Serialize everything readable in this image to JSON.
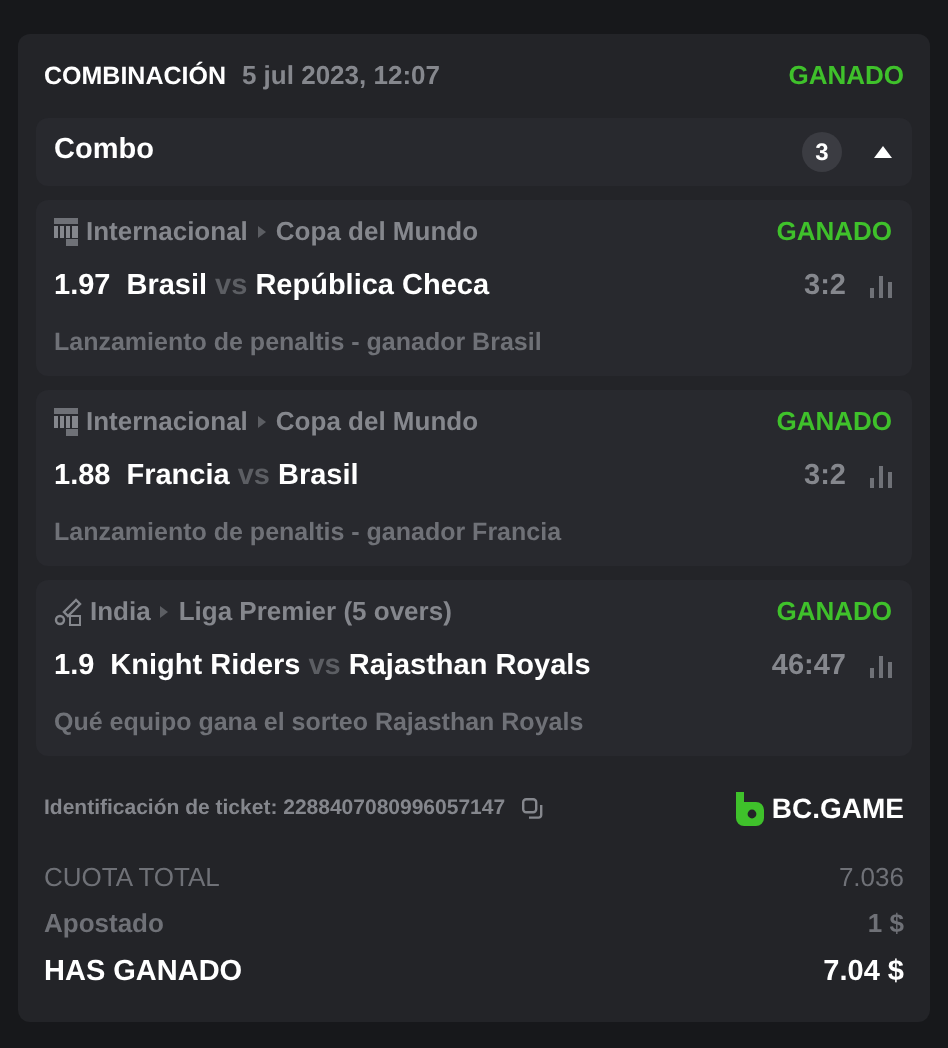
{
  "header": {
    "type": "COMBINACIÓN",
    "date": "5 jul 2023, 12:07",
    "status": "GANADO"
  },
  "combo": {
    "label": "Combo",
    "count": "3",
    "expanded": true
  },
  "legs": [
    {
      "kind": "fifa",
      "country": "Internacional",
      "league": "Copa del Mundo",
      "status": "GANADO",
      "odds": "1.97",
      "home": "Brasil",
      "vs": "vs",
      "away": "República Checa",
      "score": "3:2",
      "market": "Lanzamiento de penaltis - ganador Brasil"
    },
    {
      "kind": "fifa",
      "country": "Internacional",
      "league": "Copa del Mundo",
      "status": "GANADO",
      "odds": "1.88",
      "home": "Francia",
      "vs": "vs",
      "away": "Brasil",
      "score": "3:2",
      "market": "Lanzamiento de penaltis - ganador Francia"
    },
    {
      "kind": "cricket",
      "country": "India",
      "league": "Liga Premier (5 overs)",
      "status": "GANADO",
      "odds": "1.9",
      "home": "Knight Riders",
      "vs": "vs",
      "away": "Rajasthan Royals",
      "score": "46:47",
      "market": "Qué equipo gana el sorteo Rajasthan Royals"
    }
  ],
  "ticket": {
    "label": "Identificación de ticket: 2288407080996057147",
    "brand": "BC.GAME"
  },
  "totals": [
    {
      "kind": "muted",
      "label": "CUOTA TOTAL",
      "value": "7.036"
    },
    {
      "kind": "muted-bold",
      "label": "Apostado",
      "value": "1 $"
    },
    {
      "kind": "strong",
      "label": "HAS GANADO",
      "value": "7.04 $"
    }
  ]
}
